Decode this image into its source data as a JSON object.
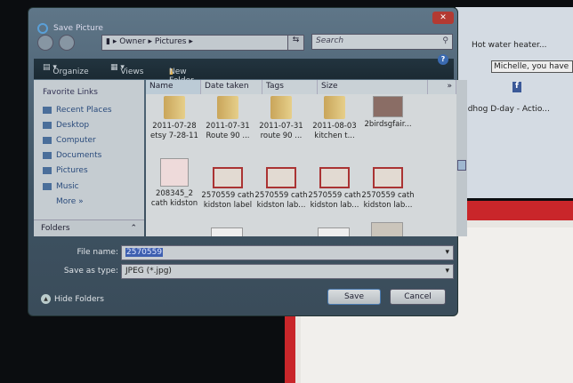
{
  "browser": {
    "tab_title": "Hot water heater...",
    "message_box": "Michelle, you have",
    "feed_text": "ndhog D-day - Actio...",
    "facebook": "f"
  },
  "dialog": {
    "title": "Save Picture",
    "close": "✕",
    "breadcrumb": [
      "Owner",
      "Pictures"
    ],
    "search_placeholder": "Search",
    "toolbar": {
      "organize": "Organize",
      "views": "Views",
      "new_folder": "New Folder",
      "help": "?"
    },
    "sidebar": {
      "heading": "Favorite Links",
      "items": [
        "Recent Places",
        "Desktop",
        "Computer",
        "Documents",
        "Pictures",
        "Music",
        "More"
      ],
      "folders": "Folders"
    },
    "columns": [
      "Name",
      "Date taken",
      "Tags",
      "Size",
      "»"
    ],
    "files": [
      {
        "label": "2011-07-28 etsy 7-28-11",
        "type": "folder"
      },
      {
        "label": "2011-07-31 Route 90 ...",
        "type": "folder"
      },
      {
        "label": "2011-07-31 route 90 ...",
        "type": "folder"
      },
      {
        "label": "2011-08-03 kitchen t...",
        "type": "folder"
      },
      {
        "label": "2birdsgfair...",
        "type": "image"
      },
      {
        "label": "208345_2 cath kidston",
        "type": "image"
      },
      {
        "label": "2570559 cath kidston label",
        "type": "image"
      },
      {
        "label": "2570559 cath kidston lab...",
        "type": "image"
      },
      {
        "label": "2570559 cath kidston lab...",
        "type": "image"
      },
      {
        "label": "2570559 cath kidston lab...",
        "type": "image"
      }
    ],
    "file_name_label": "File name:",
    "file_name": "2570559",
    "save_type_label": "Save as type:",
    "save_type": "JPEG (*.jpg)",
    "hide_folders": "Hide Folders",
    "save": "Save",
    "cancel": "Cancel"
  }
}
